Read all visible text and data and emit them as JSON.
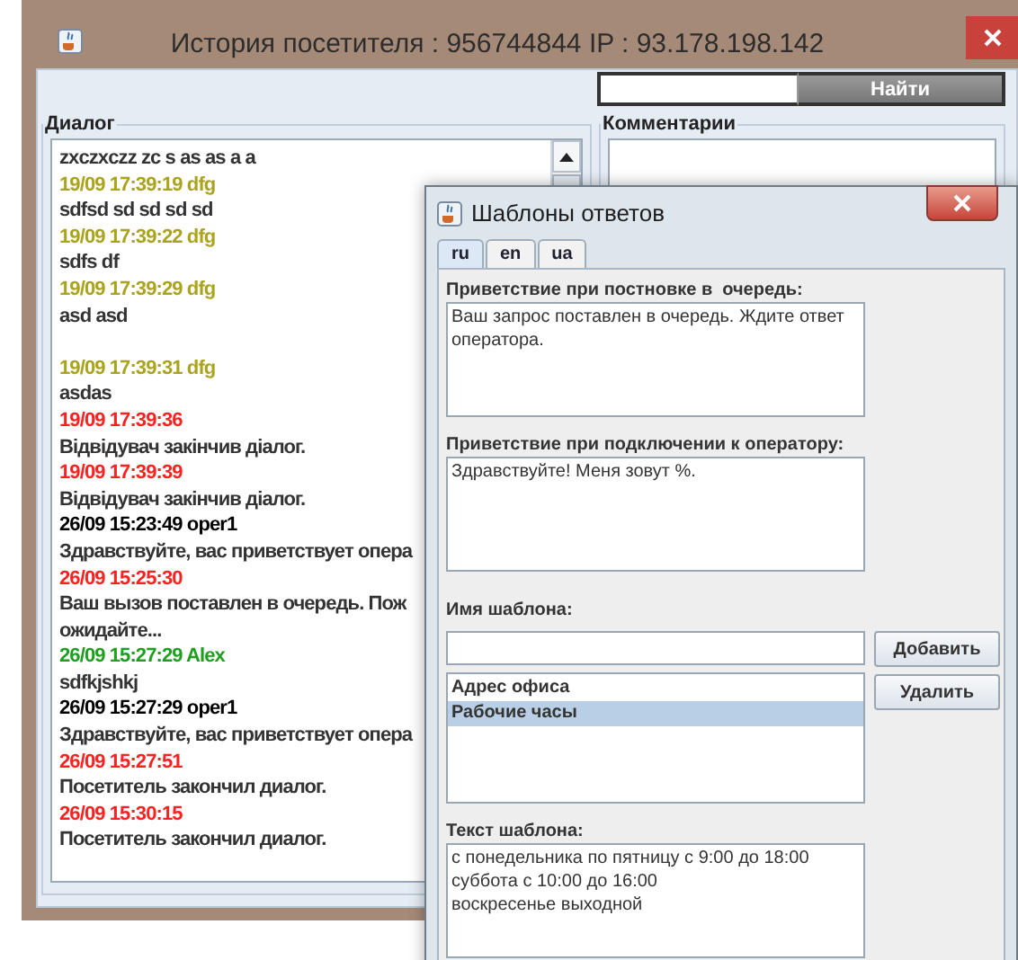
{
  "main_window": {
    "title": "История посетителя : 956744844 IP : 93.178.198.142",
    "search": {
      "button": "Найти"
    },
    "dialog_panel": {
      "title": "Диалог",
      "messages": [
        {
          "kind": "body",
          "text": "zxczxczz zc s as as a a"
        },
        {
          "kind": "header",
          "text": "19/09 17:39:19 dfg",
          "color": "#aaa31c"
        },
        {
          "kind": "body",
          "text": "sdfsd sd sd sd sd"
        },
        {
          "kind": "header",
          "text": "19/09 17:39:22 dfg",
          "color": "#aaa31c"
        },
        {
          "kind": "body",
          "text": "sdfs df"
        },
        {
          "kind": "header",
          "text": "19/09 17:39:29 dfg",
          "color": "#aaa31c"
        },
        {
          "kind": "body",
          "text": "asd asd"
        },
        {
          "kind": "blank"
        },
        {
          "kind": "header",
          "text": "19/09 17:39:31 dfg",
          "color": "#aaa31c"
        },
        {
          "kind": "body",
          "text": "asdas"
        },
        {
          "kind": "header",
          "text": "19/09 17:39:36",
          "color": "#ff2020"
        },
        {
          "kind": "body",
          "text": "Відвідувач закінчив діалог."
        },
        {
          "kind": "header",
          "text": "19/09 17:39:39",
          "color": "#ff2020"
        },
        {
          "kind": "body",
          "text": "Відвідувач закінчив діалог."
        },
        {
          "kind": "header",
          "text": "26/09 15:23:49 oper1",
          "color": "#000000"
        },
        {
          "kind": "body",
          "text": "Здравствуйте, вас приветствует опера"
        },
        {
          "kind": "header",
          "text": "26/09 15:25:30",
          "color": "#ff2020"
        },
        {
          "kind": "body",
          "text": "Ваш вызов поставлен в очередь. Пож"
        },
        {
          "kind": "body",
          "text": "ожидайте..."
        },
        {
          "kind": "header",
          "text": "26/09 15:27:29 Alex",
          "color": "#1ea01e"
        },
        {
          "kind": "body",
          "text": "sdfkjshkj"
        },
        {
          "kind": "header",
          "text": "26/09 15:27:29 oper1",
          "color": "#000000"
        },
        {
          "kind": "body",
          "text": "Здравствуйте, вас приветствует опера"
        },
        {
          "kind": "header",
          "text": "26/09 15:27:51",
          "color": "#ff2020"
        },
        {
          "kind": "body",
          "text": "Посетитель закончил диалог."
        },
        {
          "kind": "header",
          "text": "26/09 15:30:15",
          "color": "#ff2020"
        },
        {
          "kind": "body",
          "text": "Посетитель закончил диалог."
        }
      ]
    },
    "comments_panel": {
      "title": "Комментарии"
    }
  },
  "templates_dialog": {
    "title": "Шаблоны ответов",
    "tabs": [
      {
        "label": "ru",
        "selected": true
      },
      {
        "label": "en",
        "selected": false
      },
      {
        "label": "ua",
        "selected": false
      }
    ],
    "queue_greeting": {
      "label": "Приветствие при постновке в  очередь:",
      "value": "Ваш запрос поставлен в очередь. Ждите ответ оператора."
    },
    "connect_greeting": {
      "label": "Приветствие при подключении к оператору:",
      "value": "Здравствуйте! Меня зовут %."
    },
    "template_name": {
      "label": "Имя шаблона:"
    },
    "add_button": "Добавить",
    "templates": [
      {
        "label": "Адрес офиса",
        "selected": false
      },
      {
        "label": "Рабочие часы",
        "selected": true
      }
    ],
    "delete_button": "Удалить",
    "template_text": {
      "label": "Текст шаблона:",
      "value": "с понедельника по пятницу с 9:00 до 18:00\nсуббота с 10:00 до 16:00\nвоскресенье выходной"
    }
  }
}
